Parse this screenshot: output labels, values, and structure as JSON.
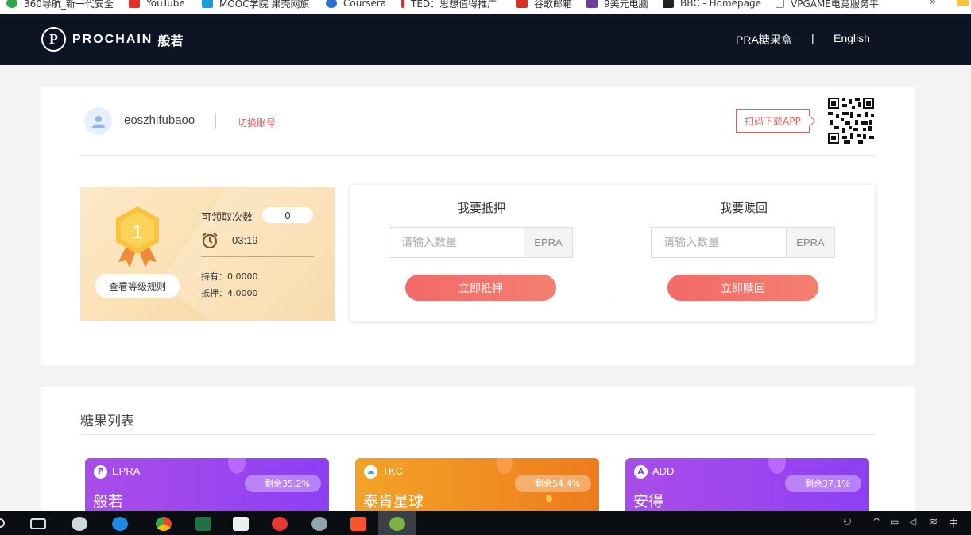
{
  "bookmarks": [
    {
      "label": "360导航_新一代安全",
      "color": "#2fa84f",
      "icon": "360-icon"
    },
    {
      "label": "YouTube",
      "color": "#e52d27",
      "icon": "youtube-icon"
    },
    {
      "label": "MOOC学院 果壳网旗",
      "color": "#1d9bd6",
      "icon": "mooc-icon"
    },
    {
      "label": "Coursera",
      "color": "#2a73cc",
      "icon": "coursera-icon"
    },
    {
      "label": "TED：思想值得推广",
      "color": "#e62b1e",
      "icon": "ted-icon"
    },
    {
      "label": "谷歌邮箱",
      "color": "#d93025",
      "icon": "gmail-icon"
    },
    {
      "label": "9美元电脑",
      "color": "#6b3fa0",
      "icon": "site-icon"
    },
    {
      "label": "BBC - Homepage",
      "color": "#222222",
      "icon": "bbc-icon"
    },
    {
      "label": "VPGAME电竞服务平",
      "color": "#888888",
      "icon": "page-icon"
    }
  ],
  "bookmarks_more": "»",
  "header": {
    "logo_mark": "P",
    "logo_text": "PROCHAIN",
    "logo_cn": "般若",
    "nav_candy": "PRA糖果盒",
    "nav_sep": "|",
    "nav_lang": "English"
  },
  "account": {
    "username": "eoszhifubaoo",
    "switch_label": "切换账号",
    "app_download": "扫码下载APP"
  },
  "level": {
    "number": "1",
    "rules_button": "查看等级规则",
    "claim_label": "可领取次数",
    "claim_count": "0",
    "timer": "03:19",
    "hold": "持有：0.0000",
    "pledged": "抵押：4.0000"
  },
  "stake": {
    "title": "我要抵押",
    "placeholder": "请输入数量",
    "unit": "EPRA",
    "button": "立即抵押"
  },
  "redeem": {
    "title": "我要赎回",
    "placeholder": "请输入数量",
    "unit": "EPRA",
    "button": "立即赎回"
  },
  "candy_list": {
    "title": "糖果列表",
    "items": [
      {
        "symbol": "EPRA",
        "name": "般若",
        "remaining": "剩余35.2%",
        "theme": "purple",
        "icon": "P"
      },
      {
        "symbol": "TKC",
        "name": "泰肯星球",
        "remaining": "剩余54.4%",
        "theme": "orange",
        "icon": "☁"
      },
      {
        "symbol": "ADD",
        "name": "安得",
        "remaining": "剩余37.1%",
        "theme": "purple",
        "icon": "A"
      }
    ]
  },
  "taskbar": {
    "tray_lang": "中"
  },
  "colors": {
    "header_bg": "#0d1424",
    "accent_red": "#f36a6a",
    "link_red": "#e06060",
    "card_purple": "#9a45ee",
    "card_orange": "#f08f22"
  }
}
